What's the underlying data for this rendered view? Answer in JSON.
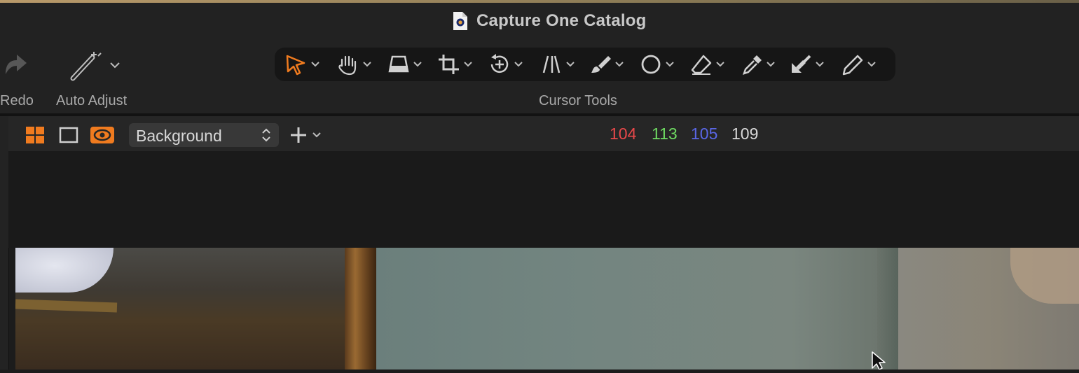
{
  "window": {
    "title": "Capture One Catalog"
  },
  "toolbar": {
    "redo_label": "Redo",
    "auto_adjust_label": "Auto Adjust",
    "cursor_tools_label": "Cursor Tools",
    "cursor_tools": [
      {
        "icon": "select-arrow-icon",
        "active": true
      },
      {
        "icon": "hand-pan-icon"
      },
      {
        "icon": "keystone-icon"
      },
      {
        "icon": "crop-icon"
      },
      {
        "icon": "rotate-icon"
      },
      {
        "icon": "straighten-icon"
      },
      {
        "icon": "brush-icon"
      },
      {
        "icon": "circle-mask-icon"
      },
      {
        "icon": "eraser-icon"
      },
      {
        "icon": "color-picker-icon"
      },
      {
        "icon": "apply-eyedropper-icon"
      },
      {
        "icon": "annotate-pen-icon"
      }
    ]
  },
  "viewer": {
    "layer_select": "Background",
    "readout": {
      "r": "104",
      "g": "113",
      "b": "105",
      "l": "109"
    }
  },
  "colors": {
    "accent": "#f07b1f",
    "red": "#e8484a",
    "green": "#6fdb62",
    "blue": "#5a67e6"
  }
}
